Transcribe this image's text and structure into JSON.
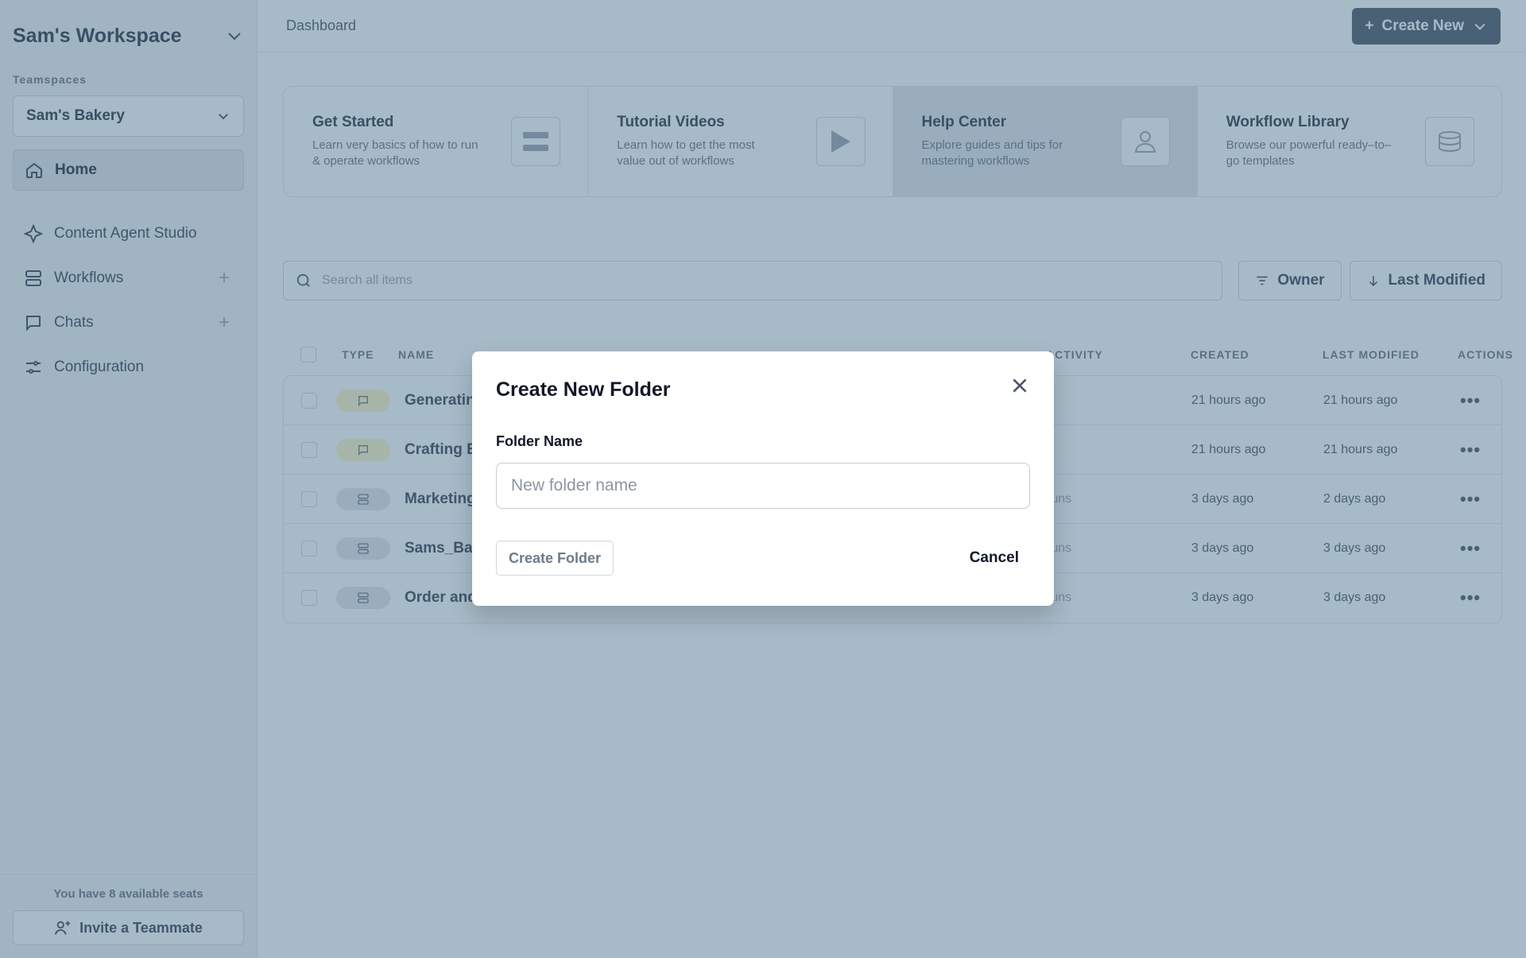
{
  "sidebar": {
    "workspace_title": "Sam's Workspace",
    "teamspaces_label": "Teamspaces",
    "teamspace_selected": "Sam's Bakery",
    "items": [
      {
        "label": "Home",
        "icon": "home-icon"
      },
      {
        "label": "Content Agent Studio",
        "icon": "sparkle-icon"
      },
      {
        "label": "Workflows",
        "icon": "workflow-icon"
      },
      {
        "label": "Chats",
        "icon": "chat-icon"
      },
      {
        "label": "Configuration",
        "icon": "sliders-icon"
      }
    ],
    "seats_text": "You have 8 available seats",
    "invite_label": "Invite a Teammate"
  },
  "header": {
    "breadcrumb": "Dashboard",
    "create_new_label": "Create New"
  },
  "cards": [
    {
      "title": "Get Started",
      "desc": "Learn very basics of how to run & operate workflows"
    },
    {
      "title": "Tutorial Videos",
      "desc": "Learn how to get the most value out of workflows"
    },
    {
      "title": "Help Center",
      "desc": "Explore guides and tips for mastering workflows"
    },
    {
      "title": "Workflow Library",
      "desc": "Browse our powerful ready–to–go templates"
    }
  ],
  "toolbar": {
    "search_placeholder": "Search all items",
    "owner_label": "Owner",
    "sort_label": "Last Modified"
  },
  "table": {
    "headers": {
      "type": "TYPE",
      "name": "NAME",
      "activity": "ACTIVITY",
      "created": "CREATED",
      "last_modified": "LAST MODIFIED",
      "actions": "ACTIONS"
    },
    "rows": [
      {
        "type": "chat",
        "name": "Generatin",
        "activity": "",
        "created": "21 hours ago",
        "modified": "21 hours ago"
      },
      {
        "type": "chat",
        "name": "Crafting E",
        "activity": "",
        "created": "21 hours ago",
        "modified": "21 hours ago"
      },
      {
        "type": "workflow",
        "name": "Marketing",
        "activity": "runs",
        "created": "3 days ago",
        "modified": "2 days ago"
      },
      {
        "type": "workflow",
        "name": "Sams_Ba",
        "activity": "runs",
        "created": "3 days ago",
        "modified": "3 days ago"
      },
      {
        "type": "workflow",
        "name": "Order and",
        "activity": "runs",
        "created": "3 days ago",
        "modified": "3 days ago"
      }
    ],
    "dots": "•••"
  },
  "modal": {
    "title": "Create New Folder",
    "field_label": "Folder Name",
    "input_value": "",
    "input_placeholder": "New folder name",
    "create_label": "Create Folder",
    "cancel_label": "Cancel"
  },
  "colors": {
    "overlay": "#486e8a",
    "sidebar_bg": "#f3f4f6",
    "create_button_bg": "#4b5563",
    "chat_pill": "#fdf6c3"
  }
}
